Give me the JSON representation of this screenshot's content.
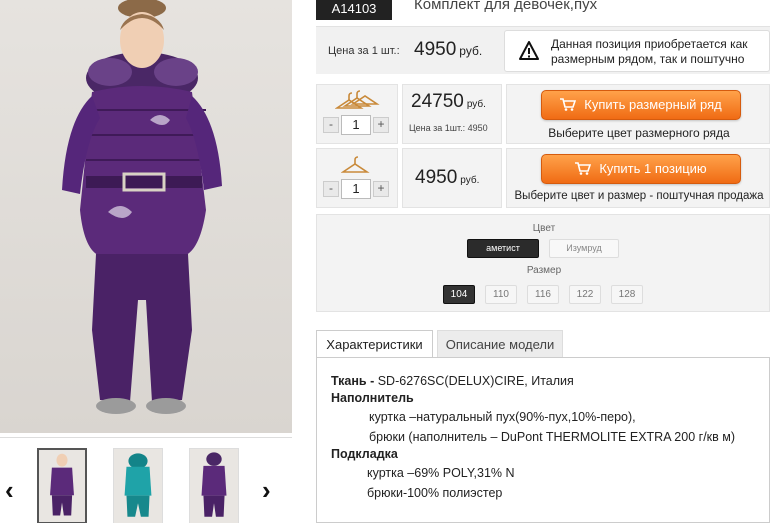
{
  "product": {
    "sku": "A14103",
    "title": "Комплект для девочек,пух"
  },
  "price_box": {
    "label": "Цена за 1 шт.:",
    "value": "4950",
    "unit": "руб.",
    "notice": "Данная позиция приобретается как размерным рядом, так и поштучно"
  },
  "buy_rows": [
    {
      "quantity": "1",
      "sum": "24750",
      "unit": "руб.",
      "sub": "Цена за 1шт.: 4950",
      "button": "Купить размерный ряд",
      "caption": "Выберите цвет размерного ряда"
    },
    {
      "quantity": "1",
      "sum": "4950",
      "unit": "руб.",
      "button": "Купить 1 позицию",
      "caption": "Выберите цвет и размер - поштучная продажа"
    }
  ],
  "options": {
    "color_label": "Цвет",
    "colors": [
      "аметист",
      "Изумруд"
    ],
    "selected_color": "аметист",
    "size_label": "Размер",
    "sizes": [
      "104",
      "110",
      "116",
      "122",
      "128"
    ],
    "selected_size": "104"
  },
  "tabs": [
    "Характеристики",
    "Описание модели"
  ],
  "specs": {
    "fabric_label": "Ткань -",
    "fabric_value": " SD-6276SC(DELUX)CIRE,  Италия",
    "filler_label": "Наполнитель",
    "filler_jacket": "куртка –натуральный пух(90%-пух,10%-перо),",
    "filler_pants": "брюки (наполнитель – DuPont THERMOLITE EXTRA 200 г/кв м)",
    "lining_label": "Подкладка",
    "lining_jacket": "куртка –69% POLY,31% N",
    "lining_pants": "брюки-100% полиэстер"
  },
  "gallery": {
    "prev": "‹",
    "next": "›"
  },
  "icons": {
    "warning": "warning-icon",
    "cart": "cart-icon",
    "hanger": "hanger-icon"
  },
  "colors": {
    "accent_orange": "#f58a2c",
    "garment_purple": "#5b2a7a",
    "garment_teal": "#1fa3a8"
  }
}
